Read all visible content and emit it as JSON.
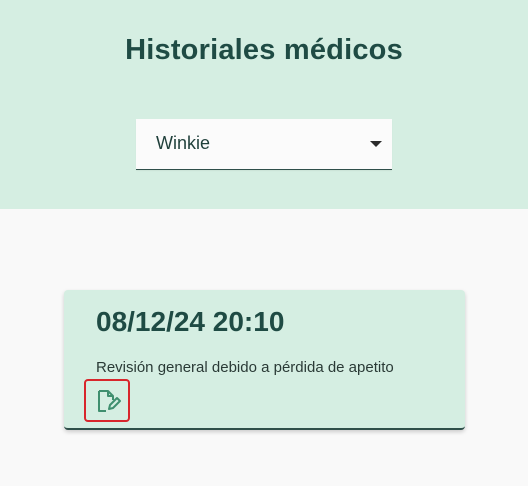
{
  "header": {
    "title": "Historiales médicos",
    "pet_select": {
      "selected": "Winkie"
    }
  },
  "records": [
    {
      "datetime": "08/12/24 20:10",
      "description": "Revisión general debido a pérdida de apetito",
      "edit_icon": "edit-document-icon"
    }
  ],
  "colors": {
    "header_bg": "#d5eee2",
    "card_bg": "#d5eee2",
    "title_text": "#1f4b44",
    "icon": "#3f8f6f",
    "highlight": "#d8262c",
    "page_bg": "#f9f9f9"
  }
}
